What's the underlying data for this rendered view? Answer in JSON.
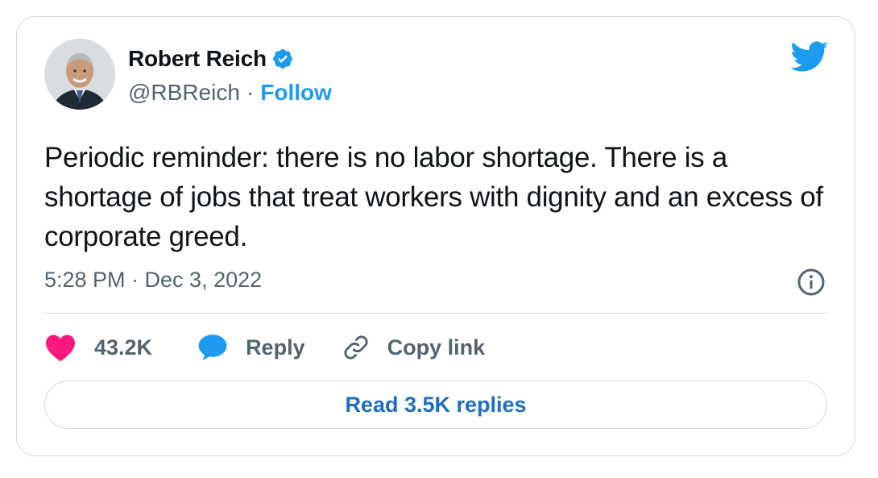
{
  "author": {
    "name": "Robert Reich",
    "handle": "@RBReich",
    "separator": "·",
    "follow_label": "Follow",
    "verified_icon": "verified-badge-icon",
    "avatar_icon": "avatar"
  },
  "tweet": {
    "text": "Periodic reminder: there is no labor shortage. There is a shortage of jobs that treat workers with dignity and an excess of corporate greed.",
    "timestamp": "5:28 PM · Dec 3, 2022"
  },
  "actions": {
    "like_count": "43.2K",
    "reply_label": "Reply",
    "copy_link_label": "Copy link"
  },
  "read_replies_label": "Read 3.5K replies",
  "colors": {
    "brand_blue": "#1d9bf0",
    "heart_pink": "#f91880",
    "text_primary": "#0f1419",
    "text_secondary": "#536471",
    "border": "#cfd9de"
  }
}
